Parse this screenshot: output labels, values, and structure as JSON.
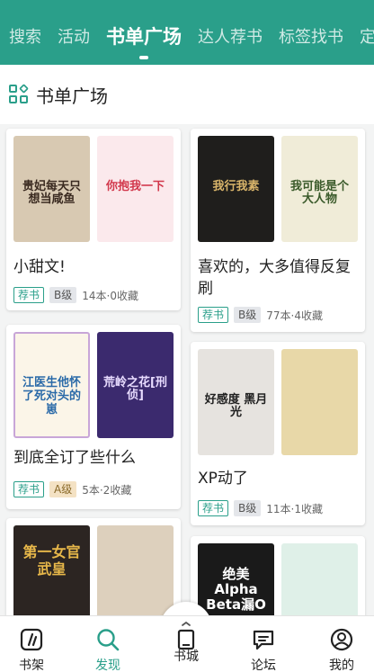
{
  "tabs": [
    "搜索",
    "活动",
    "书单广场",
    "达人荐书",
    "标签找书",
    "定"
  ],
  "active_tab": 2,
  "section_title": "书单广场",
  "cards": [
    {
      "title": "小甜文!",
      "tag": "荐书",
      "grade": "B级",
      "stats": "14本·0收藏",
      "covers": [
        {
          "text": "贵妃每天只想当咸鱼",
          "bg": "#d8c9b2",
          "fg": "#3a2a20"
        },
        {
          "text": "你抱我一下",
          "bg": "#fbe9ec",
          "fg": "#d2384c"
        }
      ]
    },
    {
      "title": "喜欢的，大多值得反复刷",
      "tag": "荐书",
      "grade": "B级",
      "stats": "77本·4收藏",
      "covers": [
        {
          "text": "我行我素",
          "bg": "#1f1e1c",
          "fg": "#d8b46a"
        },
        {
          "text": "我可能是个大人物",
          "bg": "#f0ecd8",
          "fg": "#3a5a2a"
        }
      ]
    },
    {
      "title": "到底全订了些什么",
      "tag": "荐书",
      "grade": "A级",
      "stats": "5本·2收藏",
      "covers": [
        {
          "text": "江医生他怀了死对头的崽",
          "bg": "#fbf5e8",
          "fg": "#2a6aa8"
        },
        {
          "text": "荒岭之花[刑侦]",
          "bg": "#3b2a6e",
          "fg": "#e8dcff"
        }
      ]
    },
    {
      "title": "XP动了",
      "tag": "荐书",
      "grade": "B级",
      "stats": "11本·1收藏",
      "covers": [
        {
          "text": "好感度 黑月光",
          "bg": "#e6e3df",
          "fg": "#222"
        },
        {
          "text": "",
          "bg": "#e8d8a8",
          "fg": "#333"
        }
      ]
    },
    {
      "title": "",
      "tag": "",
      "grade": "",
      "stats": "",
      "covers": [
        {
          "text": "第一女官 武皇",
          "bg": "#2c2522",
          "fg": "#e8b84a"
        },
        {
          "text": "",
          "bg": "#ddd0bd",
          "fg": "#333"
        }
      ]
    },
    {
      "title": "",
      "tag": "",
      "grade": "",
      "stats": "",
      "covers": [
        {
          "text": "绝美Alpha Beta漏O",
          "bg": "#1a1a1a",
          "fg": "#ffffff"
        },
        {
          "text": "",
          "bg": "#dff0e8",
          "fg": "#333"
        }
      ]
    }
  ],
  "nav": [
    "书架",
    "发现",
    "书城",
    "论坛",
    "我的"
  ],
  "active_nav": 1,
  "colors": {
    "brand": "#2a9f8a"
  }
}
